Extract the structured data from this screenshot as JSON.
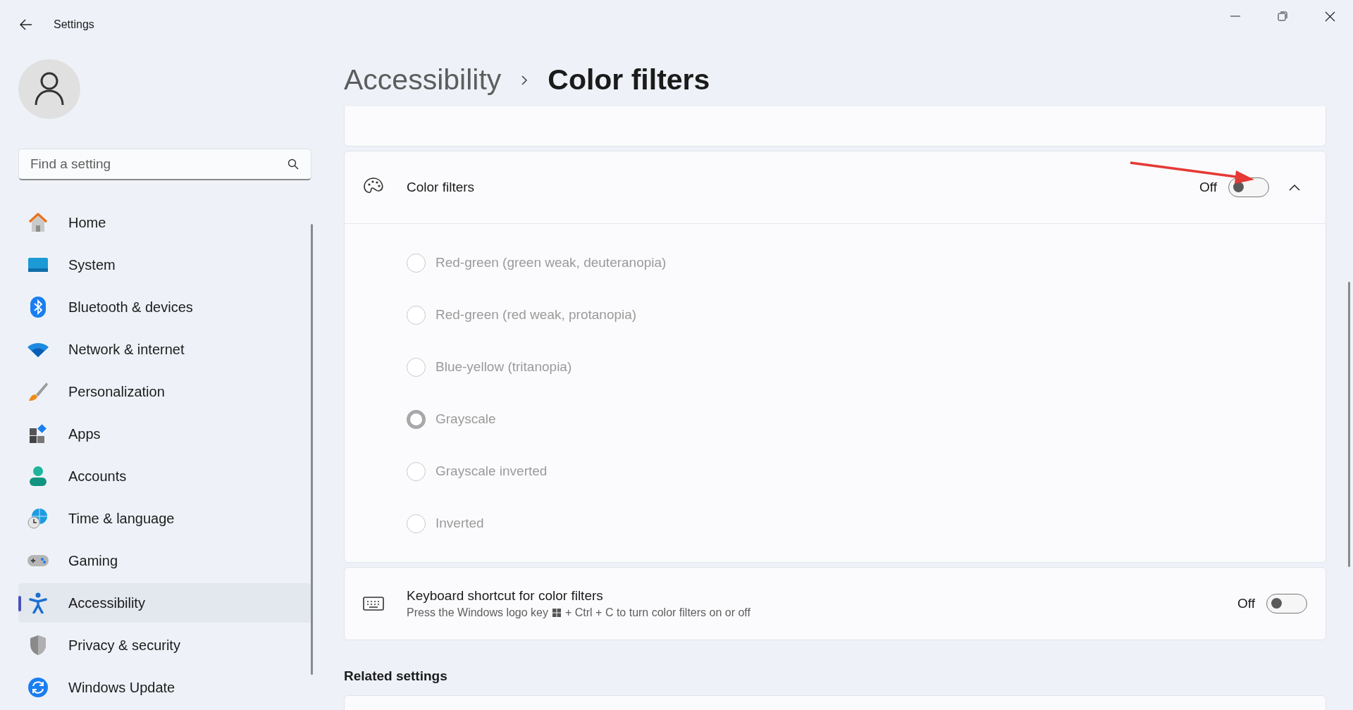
{
  "window": {
    "title": "Settings"
  },
  "search": {
    "placeholder": "Find a setting"
  },
  "nav": [
    {
      "label": "Home",
      "kind": "home",
      "selected": false
    },
    {
      "label": "System",
      "kind": "system",
      "selected": false
    },
    {
      "label": "Bluetooth & devices",
      "kind": "bluetooth",
      "selected": false
    },
    {
      "label": "Network & internet",
      "kind": "network",
      "selected": false
    },
    {
      "label": "Personalization",
      "kind": "personalization",
      "selected": false
    },
    {
      "label": "Apps",
      "kind": "apps",
      "selected": false
    },
    {
      "label": "Accounts",
      "kind": "accounts",
      "selected": false
    },
    {
      "label": "Time & language",
      "kind": "time",
      "selected": false
    },
    {
      "label": "Gaming",
      "kind": "gaming",
      "selected": false
    },
    {
      "label": "Accessibility",
      "kind": "accessibility",
      "selected": true
    },
    {
      "label": "Privacy & security",
      "kind": "privacy",
      "selected": false
    },
    {
      "label": "Windows Update",
      "kind": "update",
      "selected": false
    }
  ],
  "breadcrumb": [
    {
      "label": "Accessibility"
    },
    {
      "label": "Color filters"
    }
  ],
  "color_filters": {
    "label": "Color filters",
    "state_text": "Off",
    "on": false,
    "expanded": true,
    "options": [
      {
        "label": "Red-green (green weak, deuteranopia)",
        "selected": false
      },
      {
        "label": "Red-green (red weak, protanopia)",
        "selected": false
      },
      {
        "label": "Blue-yellow (tritanopia)",
        "selected": false
      },
      {
        "label": "Grayscale",
        "selected": true
      },
      {
        "label": "Grayscale inverted",
        "selected": false
      },
      {
        "label": "Inverted",
        "selected": false
      }
    ]
  },
  "keyboard_shortcut": {
    "label": "Keyboard shortcut for color filters",
    "description_before": "Press the Windows logo key",
    "description_after": "+ Ctrl + C to turn color filters on or off",
    "state_text": "Off",
    "on": false
  },
  "related_settings": {
    "heading": "Related settings"
  }
}
